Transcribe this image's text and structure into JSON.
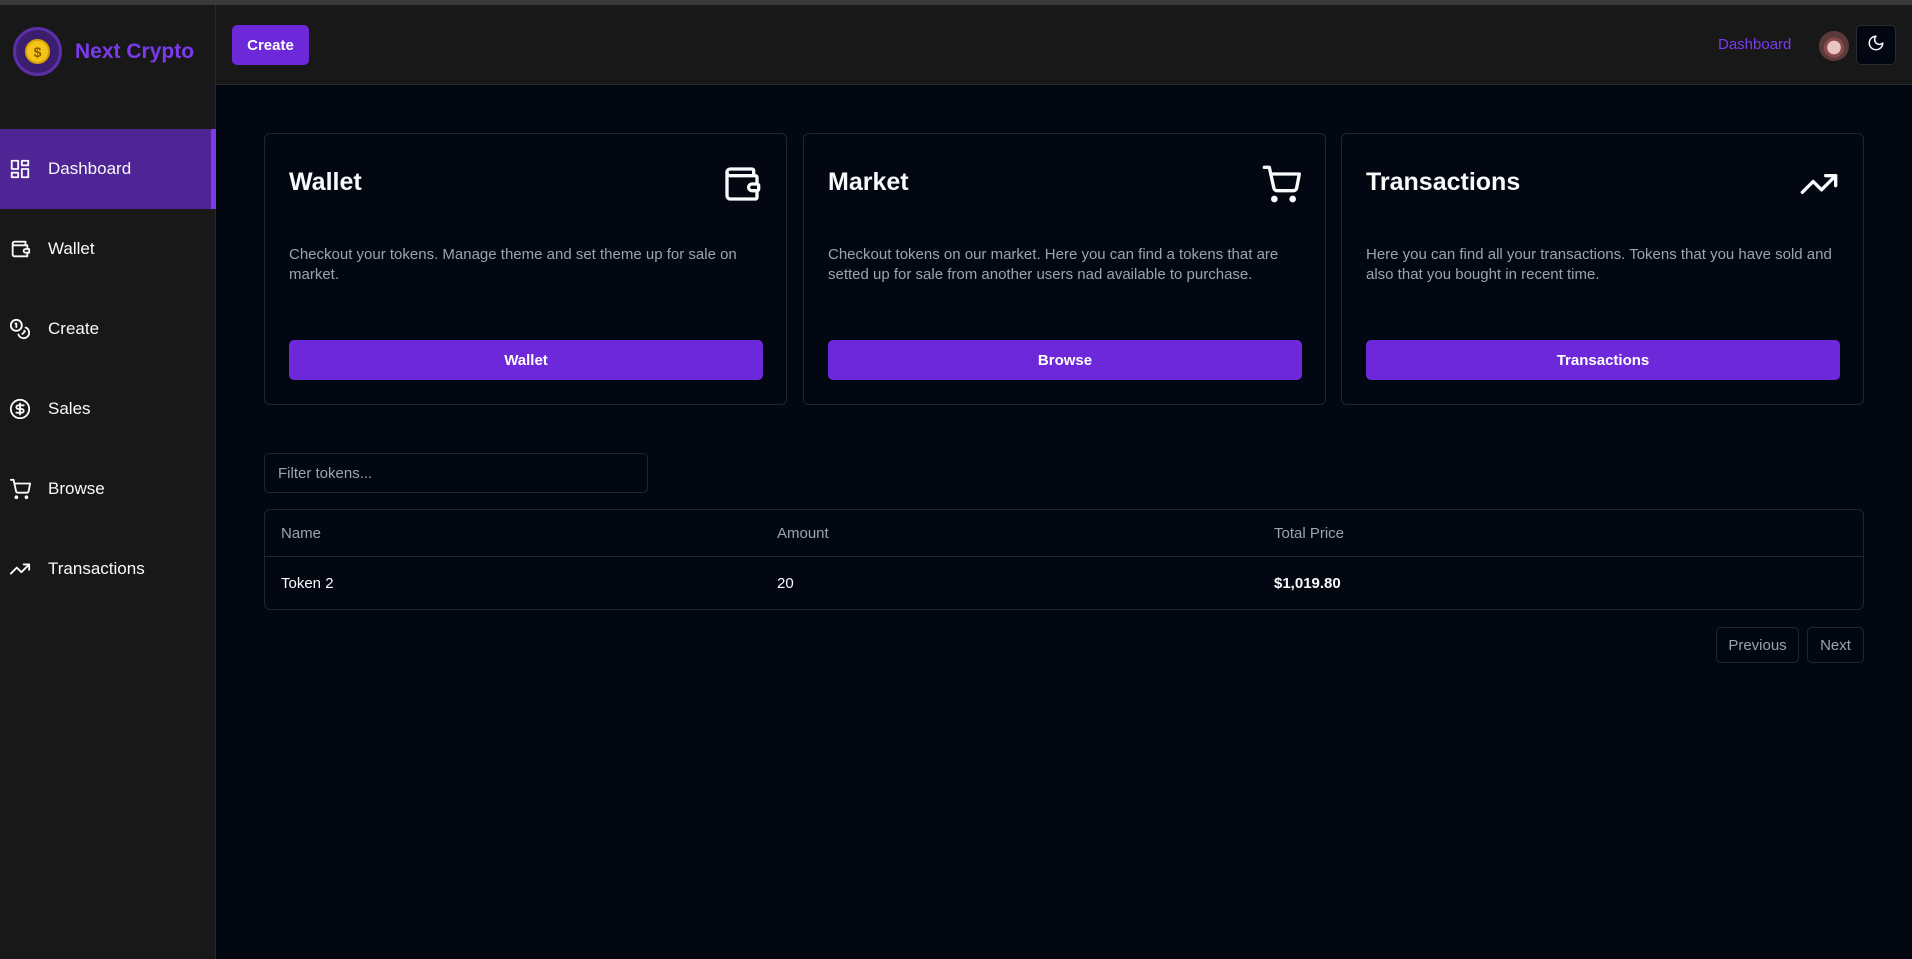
{
  "brand": {
    "name": "Next Crypto",
    "coin_glyph": "$"
  },
  "sidebar": {
    "items": [
      {
        "label": "Dashboard",
        "icon": "dashboard-icon",
        "active": true
      },
      {
        "label": "Wallet",
        "icon": "wallet-icon",
        "active": false
      },
      {
        "label": "Create",
        "icon": "coins-icon",
        "active": false
      },
      {
        "label": "Sales",
        "icon": "dollar-circle-icon",
        "active": false
      },
      {
        "label": "Browse",
        "icon": "cart-icon",
        "active": false
      },
      {
        "label": "Transactions",
        "icon": "trending-up-icon",
        "active": false
      }
    ]
  },
  "header": {
    "create_label": "Create",
    "link_label": "Dashboard",
    "theme_icon": "moon-icon"
  },
  "cards": [
    {
      "title": "Wallet",
      "icon": "wallet-icon",
      "description": "Checkout your tokens. Manage theme and set theme up for sale on market.",
      "button": "Wallet"
    },
    {
      "title": "Market",
      "icon": "cart-icon",
      "description": "Checkout tokens on our market. Here you can find a tokens that are setted up for sale from another users nad available to purchase.",
      "button": "Browse"
    },
    {
      "title": "Transactions",
      "icon": "trending-up-icon",
      "description": "Here you can find all your transactions. Tokens that you have sold and also that you bought in recent time.",
      "button": "Transactions"
    }
  ],
  "filter": {
    "placeholder": "Filter tokens...",
    "value": ""
  },
  "table": {
    "columns": [
      "Name",
      "Amount",
      "Total Price"
    ],
    "rows": [
      [
        "Token 2",
        "20",
        "$1,019.80"
      ]
    ]
  },
  "pagination": {
    "previous": "Previous",
    "next": "Next"
  },
  "colors": {
    "accent": "#6d28d9",
    "brand": "#7c3aed",
    "background": "#030711",
    "sidebar": "#181818",
    "active_nav": "#4f2494"
  }
}
